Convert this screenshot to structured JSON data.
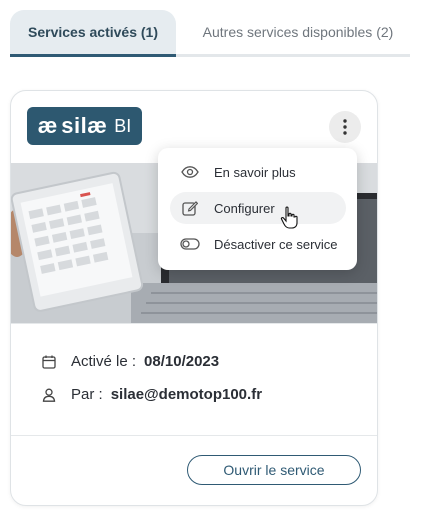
{
  "tabs": [
    {
      "label": "Services activés (1)",
      "active": true
    },
    {
      "label": "Autres services disponibles (2)",
      "active": false
    }
  ],
  "card": {
    "logo": {
      "mark": "æ",
      "brand": "silæ",
      "suffix": "BI"
    },
    "activated_label": "Activé le :",
    "activated_date": "08/10/2023",
    "by_label": "Par :",
    "by_value": "silae@demotop100.fr",
    "open_button": "Ouvrir le service"
  },
  "menu": {
    "items": [
      {
        "label": "En savoir plus",
        "icon": "eye-icon"
      },
      {
        "label": "Configurer",
        "icon": "edit-icon"
      },
      {
        "label": "Désactiver ce service",
        "icon": "toggle-off-icon"
      }
    ]
  },
  "colors": {
    "accent": "#2f5a74",
    "tab_active_bg": "#e6ecf0",
    "logo_bg": "#2d5870"
  }
}
